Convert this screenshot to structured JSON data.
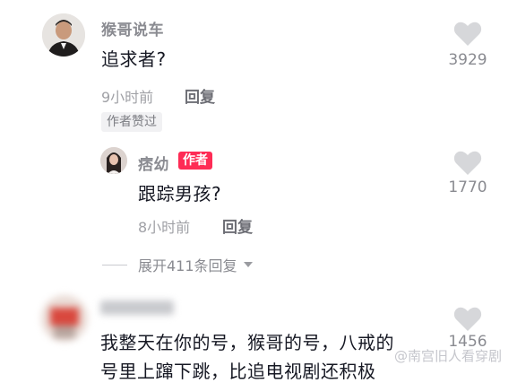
{
  "comments": [
    {
      "username": "猴哥说车",
      "text": "追求者?",
      "time": "9小时前",
      "reply_label": "回复",
      "liked_tag": "作者赞过",
      "likes": "3929",
      "heart_icon": "heart-icon"
    },
    {
      "username": "痞幼",
      "author_tag": "作者",
      "text": "跟踪男孩?",
      "time": "8小时前",
      "reply_label": "回复",
      "likes": "1770",
      "heart_icon": "heart-icon"
    },
    {
      "text": "我整天在你的号，猴哥的号，八戒的",
      "text_partial": "号里上蹿下跳，比追电视剧还积极",
      "likes": "1456",
      "heart_icon": "heart-icon"
    }
  ],
  "expand_replies": "展开411条回复",
  "colors": {
    "author_tag": "#fe2c55",
    "heart": "#d6d7da",
    "text": "#161823",
    "meta": "#a0a1a6"
  },
  "watermark": "@南宫旧人看穿剧"
}
